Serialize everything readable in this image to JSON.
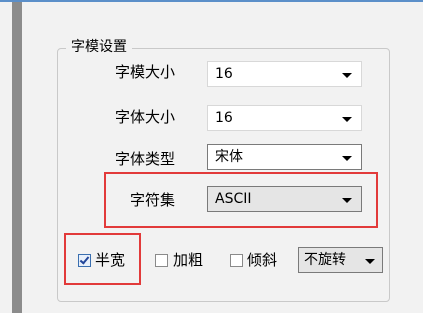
{
  "group": {
    "title": "字模设置"
  },
  "font_size_template": {
    "label": "字模大小",
    "value": "16"
  },
  "font_size_text": {
    "label": "字体大小",
    "value": "16"
  },
  "font_type": {
    "label": "字体类型",
    "value": "宋体"
  },
  "charset": {
    "label": "字符集",
    "value": "ASCII"
  },
  "options": {
    "half_width": {
      "label": "半宽",
      "checked": true
    },
    "bold": {
      "label": "加粗",
      "checked": false
    },
    "italic": {
      "label": "倾斜",
      "checked": false
    },
    "rotation": {
      "value": "不旋转"
    }
  },
  "colors": {
    "highlight": "#e23a3a",
    "accent": "#5b8fc9"
  }
}
